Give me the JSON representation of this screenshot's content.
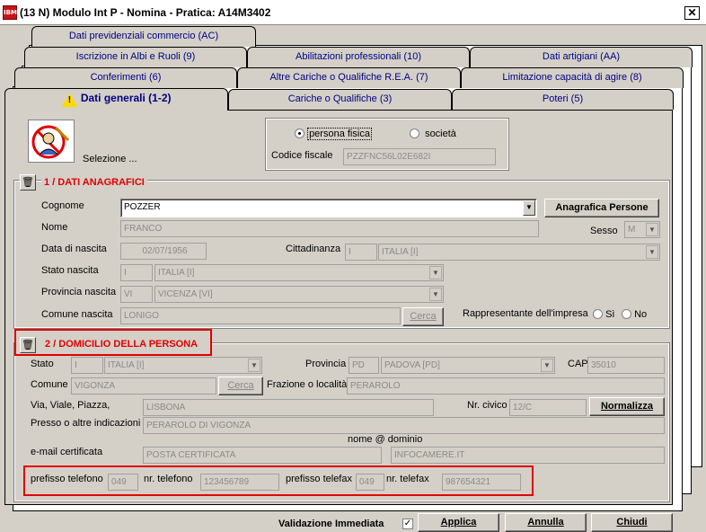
{
  "window": {
    "app_icon": "IBM",
    "title": "(13 N) Modulo Int P - Nomina - Pratica: A14M3402",
    "close": "✕"
  },
  "tabs": {
    "row1": [
      "Dati previdenziali commercio (AC)"
    ],
    "row2": [
      "Iscrizione in Albi e Ruoli (9)",
      "Abilitazioni professionali (10)",
      "Dati artigiani (AA)"
    ],
    "row3": [
      "Conferimenti (6)",
      "Altre Cariche o Qualifiche R.E.A. (7)",
      "Limitazione capacità di agire (8)"
    ],
    "row4": [
      "Dati generali (1-2)",
      "Cariche o Qualifiche (3)",
      "Poteri (5)"
    ],
    "active": "Dati generali (1-2)"
  },
  "selection": {
    "label": "Selezione ...",
    "radio_person": "persona fisica",
    "radio_company": "società",
    "selected": "persona fisica",
    "cf_label": "Codice fiscale",
    "cf_value": "PZZFNC56L02E682I"
  },
  "section1": {
    "title": "1 / DATI ANAGRAFICI",
    "cognome_label": "Cognome",
    "cognome_value": "POZZER",
    "anagrafica_button": "Anagrafica Persone",
    "nome_label": "Nome",
    "nome_value": "FRANCO",
    "sesso_label": "Sesso",
    "sesso_value": "M",
    "nascita_label": "Data di nascita",
    "nascita_value": "02/07/1956",
    "citt_label": "Cittadinanza",
    "citt_code": "I",
    "citt_value": "ITALIA [I]",
    "stato_label": "Stato nascita",
    "stato_code": "I",
    "stato_value": "ITALIA [I]",
    "prov_label": "Provincia nascita",
    "prov_code": "VI",
    "prov_value": "VICENZA [VI]",
    "comune_label": "Comune nascita",
    "comune_value": "LONIGO",
    "cerca": "Cerca",
    "rappr_label": "Rappresentante dell'impresa",
    "si": "Sì",
    "no": "No"
  },
  "section2": {
    "title": "2 / DOMICILIO DELLA PERSONA",
    "stato_label": "Stato",
    "stato_code": "I",
    "stato_value": "ITALIA [I]",
    "prov_label": "Provincia",
    "prov_code": "PD",
    "prov_value": "PADOVA [PD]",
    "cap_label": "CAP",
    "cap_value": "35010",
    "comune_label": "Comune",
    "comune_value": "VIGONZA",
    "cerca": "Cerca",
    "frazione_label": "Frazione o località",
    "frazione_value": "PERAROLO",
    "via_label": "Via, Viale, Piazza,",
    "via_value": "LISBONA",
    "civico_label": "Nr. civico",
    "civico_value": "12/C",
    "normalizza": "Normalizza",
    "presso_label": "Presso o altre indicazioni",
    "presso_value": "PERAROLO DI VIGONZA",
    "email_header": "nome @  dominio",
    "email_label": "e-mail certificata",
    "email_name": "POSTA CERTIFICATA",
    "email_domain": "INFOCAMERE.IT",
    "pref_tel_label": "prefisso telefono",
    "pref_tel_value": "049",
    "tel_label": "nr. telefono",
    "tel_value": "123456789",
    "pref_fax_label": "prefisso telefax",
    "pref_fax_value": "049",
    "fax_label": "nr. telefax",
    "fax_value": "987654321"
  },
  "footer": {
    "validazione_label": "Validazione Immediata",
    "validazione_checked": "✓",
    "applica": "Applica",
    "annulla": "Annulla",
    "chiudi": "Chiudi"
  },
  "colors": {
    "section_title": "#e00000",
    "tab_text": "#000080",
    "highlight_box": "#e00000"
  }
}
